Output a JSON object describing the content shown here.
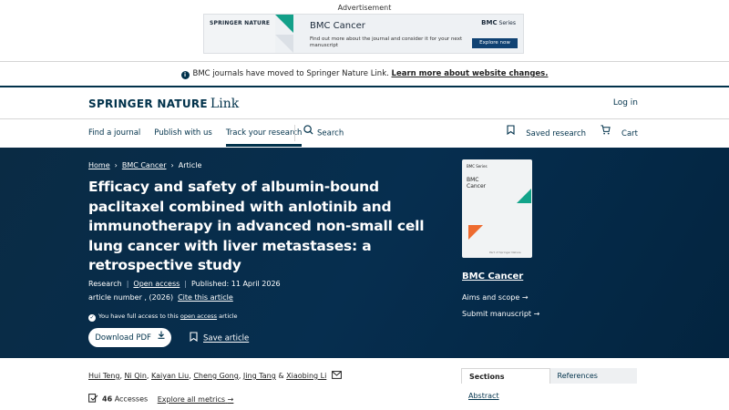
{
  "ad": {
    "label": "Advertisement",
    "brand": "SPRINGER NATURE",
    "title": "BMC Cancer",
    "description": "Find out more about the journal and consider it for your next manuscript",
    "series": "BMC",
    "series_suffix": "Series",
    "cta": "Explore now"
  },
  "notice": {
    "text": "BMC journals have moved to Springer Nature Link.",
    "link": "Learn more about website changes."
  },
  "header": {
    "logo_brand": "SPRINGER NATURE",
    "logo_link": "Link",
    "login": "Log in"
  },
  "nav": {
    "items": [
      "Find a journal",
      "Publish with us",
      "Track your research"
    ],
    "search": "Search",
    "saved": "Saved research",
    "cart": "Cart"
  },
  "breadcrumb": {
    "home": "Home",
    "journal": "BMC Cancer",
    "current": "Article"
  },
  "article": {
    "title": "Efficacy and safety of albumin-bound paclitaxel combined with anlotinib and immunotherapy in advanced non-small cell lung cancer with liver metastases: a retrospective study",
    "type": "Research",
    "open_access": "Open access",
    "published": "Published: 11 April 2026",
    "article_number": "article number , (2026)",
    "cite": "Cite this article",
    "access_prefix": "You have full access to this",
    "access_link": "open access",
    "access_suffix": "article",
    "download": "Download PDF",
    "save": "Save article"
  },
  "sidebar": {
    "cover_series": "BMC Series",
    "cover_title_1": "BMC",
    "cover_title_2": "Cancer",
    "cover_footer": "Part of Springer Nature",
    "journal": "BMC Cancer",
    "aims": "Aims and scope",
    "submit": "Submit manuscript"
  },
  "authors": [
    "Hui Teng",
    "Ni Qin",
    "Kaiyan Liu",
    "Cheng Gong",
    "Jing Tang",
    "Xiaobing Li"
  ],
  "metrics": {
    "accesses_count": "46",
    "accesses_label": "Accesses",
    "explore": "Explore all metrics"
  },
  "toc": {
    "tabs": [
      "Sections",
      "References"
    ],
    "first": "Abstract"
  }
}
